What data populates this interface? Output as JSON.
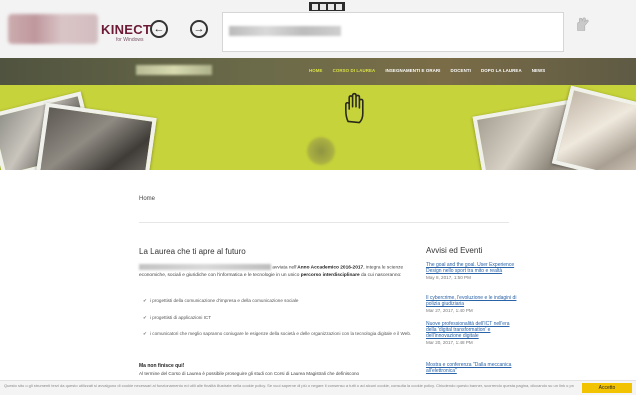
{
  "header": {
    "brand": "KINECT",
    "brand_sub": "for Windows",
    "back_icon": "back-arrow-icon",
    "forward_icon": "forward-arrow-icon"
  },
  "nav": {
    "items": [
      {
        "label": "HOME",
        "active": true
      },
      {
        "label": "CORSO DI LAUREA",
        "active": true
      },
      {
        "label": "INSEGNAMENTI E ORARI",
        "active": false
      },
      {
        "label": "DOCENTI",
        "active": false
      },
      {
        "label": "DOPO LA LAUREA",
        "active": false
      },
      {
        "label": "NEWS",
        "active": false
      }
    ]
  },
  "breadcrumb": "Home",
  "main": {
    "title": "La Laurea che ti apre al futuro",
    "intro_after_blur": " avviata nell'",
    "intro_bold_year": "Anno Accademico 2016-2017",
    "intro_rest": ", integra le scienze economiche, sociali e giuridiche con l'informatica e le tecnologie in un unico ",
    "intro_bold_path": "percorso interdisciplinare",
    "intro_end": " da cui nasceranno:",
    "bullets": [
      "i progettisti della comunicazione d'impresa e della comunicazione sociale",
      "i progettisti di applicazioni ICT",
      "i comunicatori che meglio sapranno coniugare le esigenze della società e delle organizzazioni con la tecnologia digitale e il Web."
    ],
    "sub_title": "Ma non finisce qui!",
    "sub_text": "Al termine del Corso di Laurea è possibile proseguire gli studi con Corsi di Laurea Magistrali che definiscono"
  },
  "sidebar": {
    "title": "Avvisi ed Eventi",
    "events": [
      {
        "title": "The goal and the goal. User Experience Design nello sport tra mito e realtà",
        "date": "May 8, 2017, 1:50 PM"
      },
      {
        "title": "Il cybercrime, l'evoluzione e le indagini di polizia giudiziaria",
        "date": "Mar 27, 2017, 1:40 PM"
      },
      {
        "title": "Nuove professionalità dell'ICT nell'era della 'digital transformation' e dell'innovazione digitale",
        "date": "Mar 20, 2017, 1:48 PM"
      },
      {
        "title": "Mostra e conferenza \"Dalla meccanica all'elettronica\"",
        "date": ""
      }
    ]
  },
  "cookie": {
    "text": "Questo sito o gli strumenti terzi da questo utilizzati si avvalgono di cookie necessari al funzionamento ed utili alle finalità illustrate nella cookie policy. Se vuoi saperne di più o negare il consenso a tutti o ad alcuni cookie, consulta la cookie policy. Chiudendo questo banner, scorrendo questa pagina, cliccando su un link o proseguendo la navigazione in altra maniera, acconsenti all'uso dei cookie.",
    "accept": "Accetto"
  },
  "colors": {
    "accent": "#c6d33a",
    "brand": "#6c1a35",
    "link": "#2a63a8",
    "cookie_button": "#f2c300"
  }
}
